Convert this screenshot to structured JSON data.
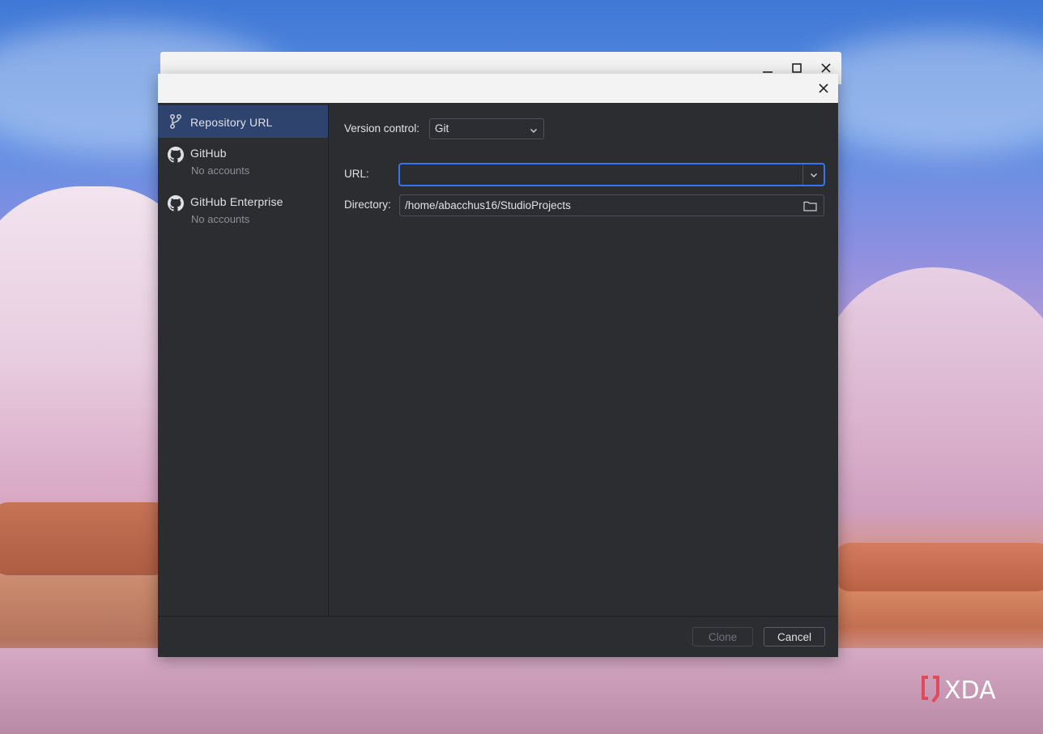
{
  "dialog": {
    "sidebar": {
      "items": [
        {
          "label": "Repository URL",
          "subtitle": "",
          "icon": "git-branch-icon",
          "selected": true
        },
        {
          "label": "GitHub",
          "subtitle": "No accounts",
          "icon": "github-icon",
          "selected": false
        },
        {
          "label": "GitHub Enterprise",
          "subtitle": "No accounts",
          "icon": "github-icon",
          "selected": false
        }
      ]
    },
    "form": {
      "version_control_label": "Version control:",
      "version_control_value": "Git",
      "url_label": "URL:",
      "url_value": "",
      "directory_label": "Directory:",
      "directory_value": "/home/abacchus16/StudioProjects"
    },
    "footer": {
      "clone_label": "Clone",
      "cancel_label": "Cancel"
    }
  },
  "watermark": {
    "text": "XDA"
  },
  "colors": {
    "dialog_bg": "#2b2d30",
    "selection": "#2e436e",
    "focus_border": "#3574f0",
    "text": "#dfe1e5",
    "muted_text": "#8b8e94"
  }
}
